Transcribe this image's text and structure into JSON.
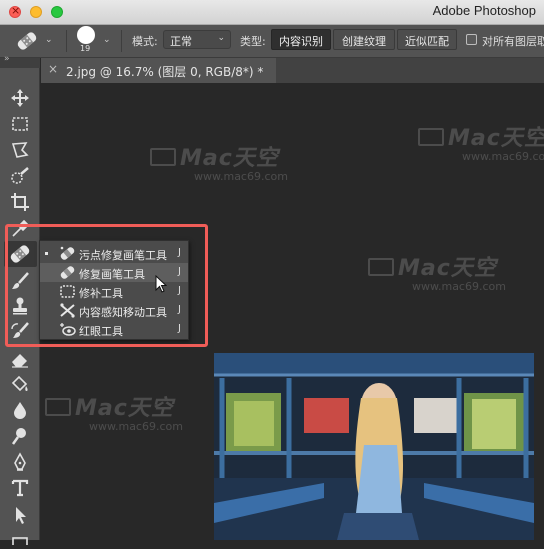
{
  "window": {
    "app_title": "Adobe Photoshop"
  },
  "options_bar": {
    "brush_size": "19",
    "mode_label": "模式:",
    "mode_value": "正常",
    "type_label": "类型:",
    "type_buttons": [
      "内容识别",
      "创建纹理",
      "近似匹配"
    ],
    "active_type": "内容识别",
    "sample_all_label": "对所有图层取样"
  },
  "toolbar": {
    "collapse_glyph": "»",
    "tools": [
      "move-icon",
      "marquee-icon",
      "lasso-icon",
      "quick-select-icon",
      "crop-icon",
      "eyedropper-icon",
      "spot-healing-icon",
      "brush-icon",
      "clone-stamp-icon",
      "history-brush-icon",
      "eraser-icon",
      "paint-bucket-icon",
      "blur-icon",
      "dodge-icon",
      "pen-icon",
      "type-icon",
      "path-select-icon"
    ]
  },
  "document_tab": {
    "close_glyph": "×",
    "title": "2.jpg @ 16.7% (图层 0, RGB/8*) *"
  },
  "flyout": {
    "items": [
      {
        "label": "污点修复画笔工具",
        "shortcut": "J",
        "icon": "spot-healing-brush-icon",
        "selected": true
      },
      {
        "label": "修复画笔工具",
        "shortcut": "J",
        "icon": "healing-brush-icon",
        "hovered": true
      },
      {
        "label": "修补工具",
        "shortcut": "J",
        "icon": "patch-icon"
      },
      {
        "label": "内容感知移动工具",
        "shortcut": "J",
        "icon": "content-aware-move-icon"
      },
      {
        "label": "红眼工具",
        "shortcut": "J",
        "icon": "red-eye-icon"
      }
    ]
  },
  "watermark": {
    "text": "Mac天空",
    "url": "www.mac69.com"
  },
  "colors": {
    "highlight": "#f05d58",
    "panel": "#535353",
    "canvas": "#282828"
  }
}
